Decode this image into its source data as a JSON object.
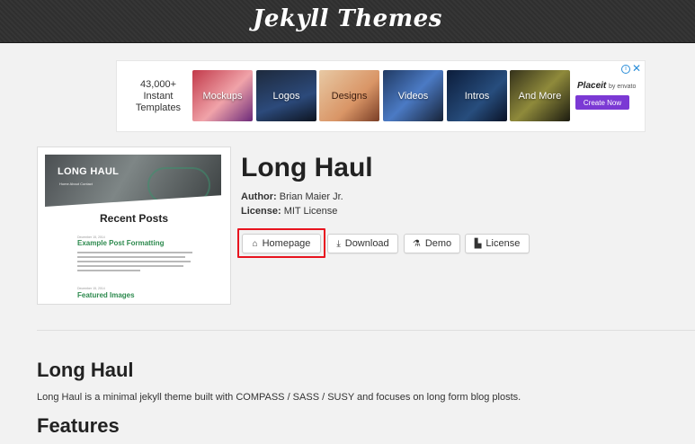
{
  "header": {
    "logo": "Jekyll Themes"
  },
  "ad": {
    "count_line1": "43,000+",
    "count_line2": "Instant",
    "count_line3": "Templates",
    "tiles": [
      "Mockups",
      "Logos",
      "Designs",
      "Videos",
      "Intros",
      "And More"
    ],
    "brand": "Placeit",
    "brand_sub": "by envato",
    "cta": "Create Now",
    "info_icon": "info-icon",
    "close_icon": "close-icon"
  },
  "preview": {
    "site_title": "LONG HAUL",
    "nav": "Home   About   Contact",
    "heading": "Recent Posts",
    "date1": "December 15, 2014",
    "post1": "Example Post Formatting",
    "date2": "December 15, 2014",
    "post2": "Featured Images"
  },
  "theme": {
    "title": "Long Haul",
    "author_label": "Author:",
    "author": "Brian Maier Jr.",
    "license_label": "License:",
    "license": "MIT License"
  },
  "buttons": {
    "homepage": "Homepage",
    "download": "Download",
    "demo": "Demo",
    "license": "License"
  },
  "content": {
    "heading": "Long Haul",
    "description": "Long Haul is a minimal jekyll theme built with COMPASS / SASS / SUSY and focuses on long form blog plosts.",
    "features_heading": "Features"
  },
  "colors": {
    "highlight": "#e8141f",
    "accent_green": "#2d8a4e",
    "cta_purple": "#7b39d4"
  }
}
